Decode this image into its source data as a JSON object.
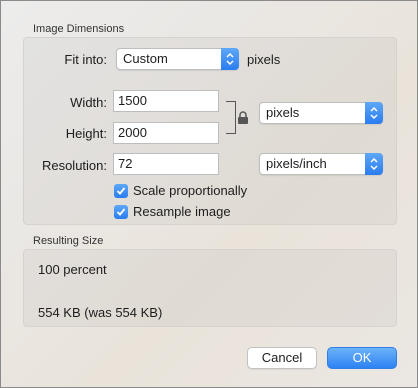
{
  "dimensions": {
    "title": "Image Dimensions",
    "fit_into_label": "Fit into:",
    "fit_into_value": "Custom",
    "fit_into_unit": "pixels",
    "width_label": "Width:",
    "width_value": "1500",
    "height_label": "Height:",
    "height_value": "2000",
    "size_unit_value": "pixels",
    "resolution_label": "Resolution:",
    "resolution_value": "72",
    "resolution_unit_value": "pixels/inch",
    "scale_label": "Scale proportionally",
    "scale_checked": true,
    "resample_label": "Resample image",
    "resample_checked": true
  },
  "result": {
    "title": "Resulting Size",
    "percent": "100 percent",
    "size": "554 KB (was 554 KB)"
  },
  "buttons": {
    "cancel_label": "Cancel",
    "ok_label": "OK"
  },
  "colors": {
    "accent": "#2d82f3"
  },
  "icons": {
    "stepper": "chevron-up-down-icon",
    "lock": "lock-icon",
    "check": "checkmark-icon"
  }
}
